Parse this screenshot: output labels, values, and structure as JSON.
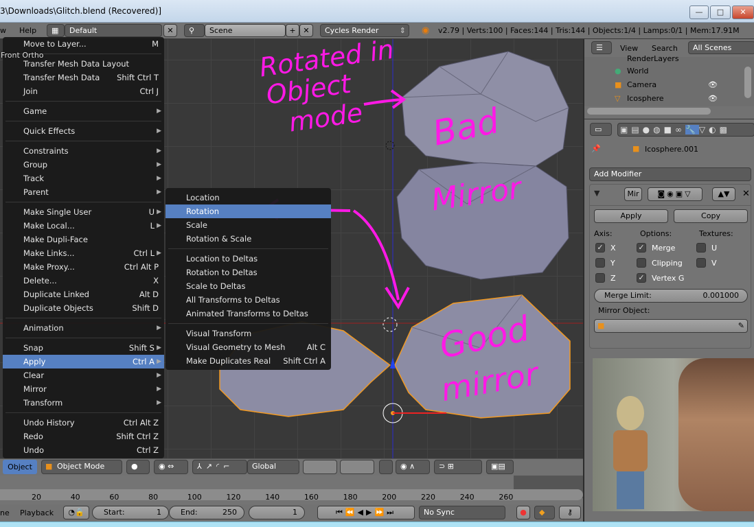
{
  "window": {
    "title": "3\\Downloads\\Glitch.blend (Recovered)]",
    "min": "—",
    "max": "□",
    "close": "✕"
  },
  "topbar": {
    "menu_help": "Help",
    "menu_view": "w",
    "layout": "Default",
    "scene": "Scene",
    "engine": "Cycles Render",
    "stats": "v2.79 | Verts:100 | Faces:144 | Tris:144 | Objects:1/4 | Lamps:0/1 | Mem:17.91M"
  },
  "viewport": {
    "label": "Front Ortho"
  },
  "object_menu": {
    "items": [
      {
        "label": "Move to Layer...",
        "shortcut": "M"
      },
      {
        "label": "Transfer Mesh Data Layout",
        "shortcut": ""
      },
      {
        "label": "Transfer Mesh Data",
        "shortcut": "Shift Ctrl T"
      },
      {
        "label": "Join",
        "shortcut": "Ctrl J"
      },
      {
        "label": "Game",
        "shortcut": "",
        "sub": true
      },
      {
        "label": "Quick Effects",
        "shortcut": "",
        "sub": true
      },
      {
        "label": "Constraints",
        "shortcut": "",
        "sub": true
      },
      {
        "label": "Group",
        "shortcut": "",
        "sub": true
      },
      {
        "label": "Track",
        "shortcut": "",
        "sub": true
      },
      {
        "label": "Parent",
        "shortcut": "",
        "sub": true
      },
      {
        "label": "Make Single User",
        "shortcut": "U",
        "sub": true
      },
      {
        "label": "Make Local...",
        "shortcut": "L",
        "sub": true
      },
      {
        "label": "Make Dupli-Face",
        "shortcut": ""
      },
      {
        "label": "Make Links...",
        "shortcut": "Ctrl L",
        "sub": true
      },
      {
        "label": "Make Proxy...",
        "shortcut": "Ctrl Alt P"
      },
      {
        "label": "Delete...",
        "shortcut": "X"
      },
      {
        "label": "Duplicate Linked",
        "shortcut": "Alt D"
      },
      {
        "label": "Duplicate Objects",
        "shortcut": "Shift D"
      },
      {
        "label": "Animation",
        "shortcut": "",
        "sub": true
      },
      {
        "label": "Snap",
        "shortcut": "Shift S",
        "sub": true
      },
      {
        "label": "Apply",
        "shortcut": "Ctrl A",
        "sub": true,
        "selected": true
      },
      {
        "label": "Clear",
        "shortcut": "",
        "sub": true
      },
      {
        "label": "Mirror",
        "shortcut": "",
        "sub": true
      },
      {
        "label": "Transform",
        "shortcut": "",
        "sub": true
      },
      {
        "label": "Undo History",
        "shortcut": "Ctrl Alt Z"
      },
      {
        "label": "Redo",
        "shortcut": "Shift Ctrl Z"
      },
      {
        "label": "Undo",
        "shortcut": "Ctrl Z"
      }
    ]
  },
  "apply_menu": {
    "items": [
      {
        "label": "Location",
        "shortcut": ""
      },
      {
        "label": "Rotation",
        "shortcut": "",
        "selected": true
      },
      {
        "label": "Scale",
        "shortcut": ""
      },
      {
        "label": "Rotation & Scale",
        "shortcut": ""
      },
      {
        "label": "Location to Deltas",
        "shortcut": ""
      },
      {
        "label": "Rotation to Deltas",
        "shortcut": ""
      },
      {
        "label": "Scale to Deltas",
        "shortcut": ""
      },
      {
        "label": "All Transforms to Deltas",
        "shortcut": ""
      },
      {
        "label": "Animated Transforms to Deltas",
        "shortcut": ""
      },
      {
        "label": "Visual Transform",
        "shortcut": ""
      },
      {
        "label": "Visual Geometry to Mesh",
        "shortcut": "Alt C"
      },
      {
        "label": "Make Duplicates Real",
        "shortcut": "Shift Ctrl A"
      }
    ]
  },
  "annotations": {
    "rotated": "Rotated in",
    "object": "Object",
    "mode": "mode",
    "bad": "Bad",
    "mirror1": "Mirror",
    "good": "Good",
    "mirror2": "mirror",
    "color": "#ff19e6"
  },
  "outliner": {
    "view": "View",
    "search": "Search",
    "filter": "All Scenes",
    "items": [
      "RenderLayers",
      "World",
      "Camera",
      "Icosphere"
    ]
  },
  "properties": {
    "object_name": "Icosphere.001",
    "add_modifier": "Add Modifier",
    "modifier_name": "Mir",
    "apply": "Apply",
    "copy": "Copy",
    "axis_label": "Axis:",
    "options_label": "Options:",
    "textures_label": "Textures:",
    "axis": [
      {
        "label": "X",
        "checked": true
      },
      {
        "label": "Y",
        "checked": false
      },
      {
        "label": "Z",
        "checked": false
      }
    ],
    "options": [
      {
        "label": "Merge",
        "checked": true
      },
      {
        "label": "Clipping",
        "checked": false
      },
      {
        "label": "Vertex G",
        "checked": true
      }
    ],
    "textures": [
      {
        "label": "U",
        "checked": false
      },
      {
        "label": "V",
        "checked": false
      }
    ],
    "merge_limit_label": "Merge Limit:",
    "merge_limit": "0.001000",
    "mirror_object_label": "Mirror Object:"
  },
  "view3d_header": {
    "object_menu": "Object",
    "mode": "Object Mode",
    "orientation": "Global"
  },
  "timeline": {
    "ticks": [
      "20",
      "40",
      "60",
      "80",
      "100",
      "120",
      "140",
      "160",
      "180",
      "200",
      "220",
      "240",
      "260"
    ],
    "menu_view": "ne",
    "playback": "Playback",
    "start_label": "Start:",
    "start": "1",
    "end_label": "End:",
    "end": "250",
    "current": "1",
    "sync": "No Sync"
  }
}
